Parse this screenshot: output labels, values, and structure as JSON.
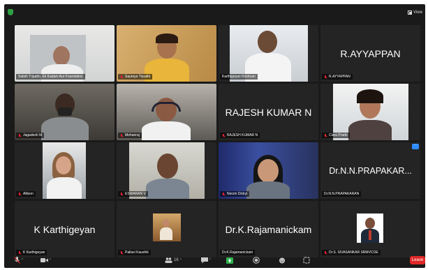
{
  "topbar": {
    "view_label": "View"
  },
  "participants": [
    {
      "name": "Satish Tripathi, Ek Kadam Aur Foundation",
      "video": true,
      "muted": false,
      "active": true
    },
    {
      "name": "Saumya Tripathi",
      "video": true,
      "muted": true
    },
    {
      "name": "Karthigeyan Krishnan",
      "video": true,
      "muted": false
    },
    {
      "name": "R.AYYAPPAN",
      "display": "R.AYYAPPAN",
      "video": false,
      "muted": true
    },
    {
      "name": "Jagadesh M",
      "video": true,
      "muted": true
    },
    {
      "name": "Mohanraj",
      "video": true,
      "muted": true
    },
    {
      "name": "RAJESH KUMAR N",
      "display": "RAJESH KUMAR N",
      "video": false,
      "muted": true
    },
    {
      "name": "Clara Prado",
      "video": true,
      "muted": true
    },
    {
      "name": "Allison",
      "video": true,
      "muted": true
    },
    {
      "name": "ESWARAN V",
      "video": true,
      "muted": true
    },
    {
      "name": "Nerzin Dickyi",
      "video": true,
      "muted": true
    },
    {
      "name": "Dr.N.N.PRAPAKARAN",
      "display": "Dr.N.N.PRAPAKAR...",
      "video": false,
      "muted": false
    },
    {
      "name": "K Karthigeyan",
      "display": "K Karthigeyan",
      "video": false,
      "muted": true
    },
    {
      "name": "Pallavi Kaushik",
      "video": true,
      "muted": true
    },
    {
      "name": "Dr.K.Rajamanickam",
      "display": "Dr.K.Rajamanickam",
      "video": false,
      "muted": false
    },
    {
      "name": "Dr.S. SIVASANKAR SRMVCOE",
      "video": true,
      "muted": true
    }
  ],
  "toolbar": {
    "participants_count": "16",
    "leave_label": "Leave"
  },
  "colors": {
    "active_speaker": "#2fd35a",
    "leave": "#e02828",
    "tile_bg": "#242424"
  }
}
